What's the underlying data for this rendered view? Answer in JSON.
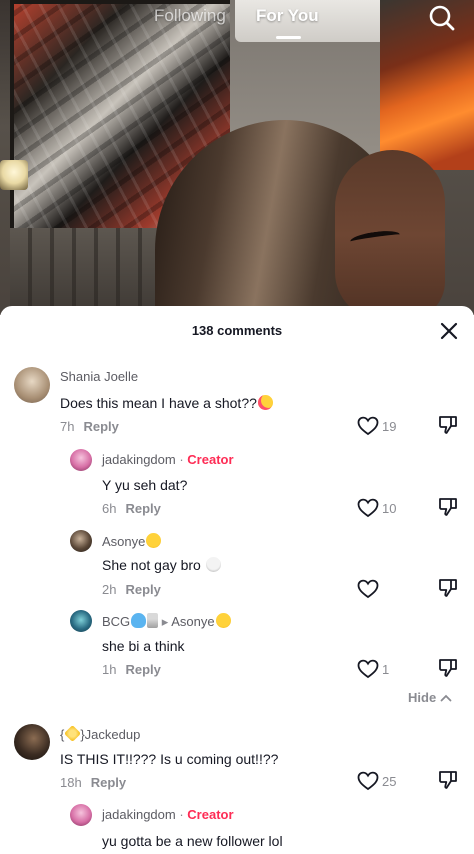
{
  "nav": {
    "tabs": [
      {
        "label": "Following",
        "active": false
      },
      {
        "label": "For You",
        "active": true
      }
    ],
    "search_icon": "search-icon"
  },
  "comments_panel": {
    "count_label": "138 comments",
    "close_icon": "close-icon",
    "hide_label": "Hide"
  },
  "comments": [
    {
      "user": "Shania Joelle",
      "text": "Does this mean I have a shot??",
      "emoji": "smiling-face-with-hearts",
      "time": "7h",
      "reply_label": "Reply",
      "likes": "19"
    },
    {
      "user": "jadakingdom",
      "badge": "Creator",
      "text": "Y yu seh dat?",
      "time": "6h",
      "reply_label": "Reply",
      "likes": "10"
    },
    {
      "user": "Asonye",
      "user_emoji": "weary-face",
      "text": "She not gay bro",
      "emoji": "skull",
      "time": "2h",
      "reply_label": "Reply",
      "likes": ""
    },
    {
      "user": "BCG",
      "user_emoji": "blue-heart, cocktail",
      "reply_to": "Asonye",
      "reply_to_emoji": "weary-face",
      "text": "she bi a think",
      "time": "1h",
      "reply_label": "Reply",
      "likes": "1"
    },
    {
      "user_prefix": "{",
      "user_star": "star",
      "user": "}Jackedup",
      "text": "IS THIS IT!!??? Is u coming out!!??",
      "time": "18h",
      "reply_label": "Reply",
      "likes": "25"
    },
    {
      "user": "jadakingdom",
      "badge": "Creator",
      "text": "yu gotta be a new follower lol"
    }
  ],
  "colors": {
    "accent": "#fe2c55",
    "text": "#161823",
    "muted": "#8a8b91"
  }
}
